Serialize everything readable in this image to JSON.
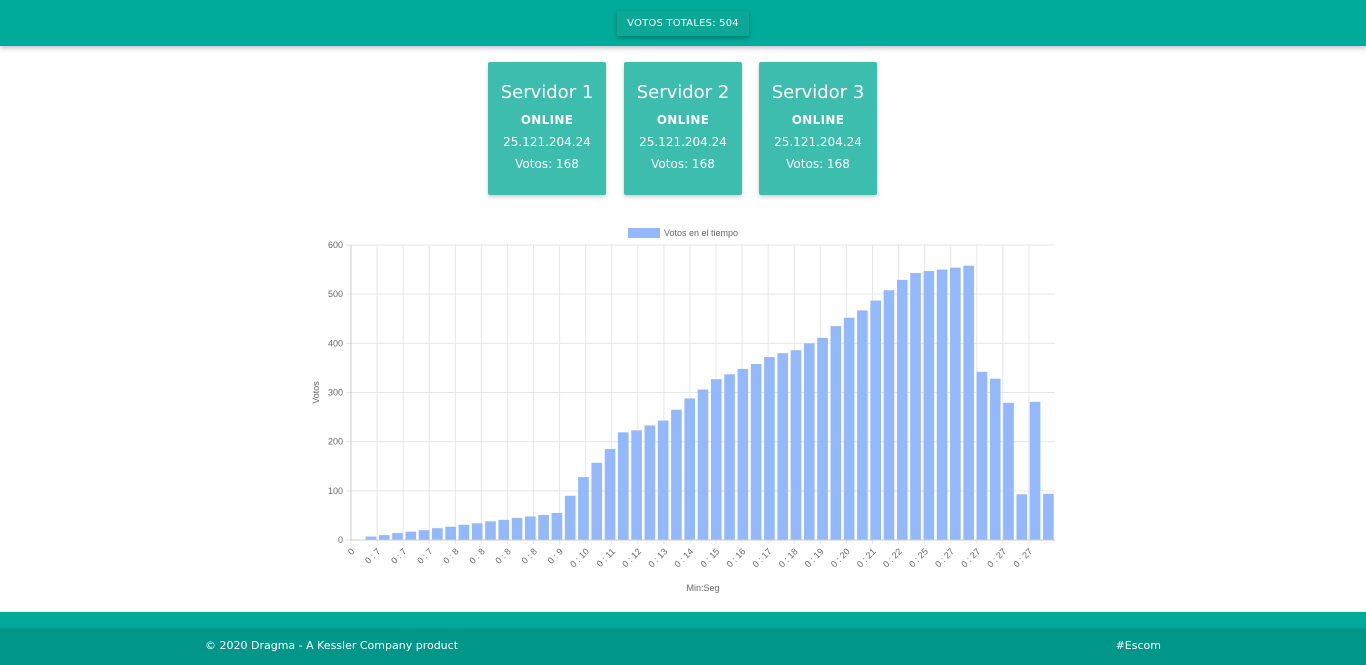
{
  "header": {
    "total_votes_label": "VOTOS TOTALES: 504"
  },
  "servers": [
    {
      "name": "Servidor 1",
      "status": "ONLINE",
      "ip": "25.121.204.24",
      "votes_label": "Votos: 168"
    },
    {
      "name": "Servidor 2",
      "status": "ONLINE",
      "ip": "25.121.204.24",
      "votes_label": "Votos: 168"
    },
    {
      "name": "Servidor 3",
      "status": "ONLINE",
      "ip": "25.121.204.24",
      "votes_label": "Votos: 168"
    }
  ],
  "chart_data": {
    "type": "bar",
    "legend": "Votos en el tiempo",
    "legend_position": "top-center",
    "xlabel": "Min:Seg",
    "ylabel": "Votos",
    "ylim": [
      0,
      600
    ],
    "yticks": [
      0,
      100,
      200,
      300,
      400,
      500,
      600
    ],
    "grid": true,
    "color": "#93b8fc",
    "tick_labels": [
      "0",
      "0 : 7",
      "0 : 7",
      "0 : 7",
      "0 : 8",
      "0 : 8",
      "0 : 8",
      "0 : 8",
      "0 : 9",
      "0 : 10",
      "0 : 11",
      "0 : 12",
      "0 : 13",
      "0 : 14",
      "0 : 15",
      "0 : 16",
      "0 : 17",
      "0 : 18",
      "0 : 19",
      "0 : 20",
      "0 : 21",
      "0 : 22",
      "0 : 25",
      "0 : 27",
      "0 : 27",
      "0 : 27",
      "0 : 27"
    ],
    "values": [
      0,
      7,
      10,
      14,
      17,
      20,
      24,
      27,
      31,
      34,
      38,
      41,
      45,
      48,
      51,
      55,
      90,
      128,
      157,
      185,
      219,
      223,
      233,
      243,
      265,
      288,
      306,
      327,
      337,
      348,
      358,
      372,
      380,
      386,
      400,
      411,
      435,
      452,
      467,
      487,
      508,
      529,
      543,
      547,
      550,
      554,
      558,
      342,
      328,
      279,
      93,
      281,
      94
    ]
  },
  "footer": {
    "copyright": "© 2020 Dragma - A Kessler Company product",
    "tag": "#Escom"
  }
}
